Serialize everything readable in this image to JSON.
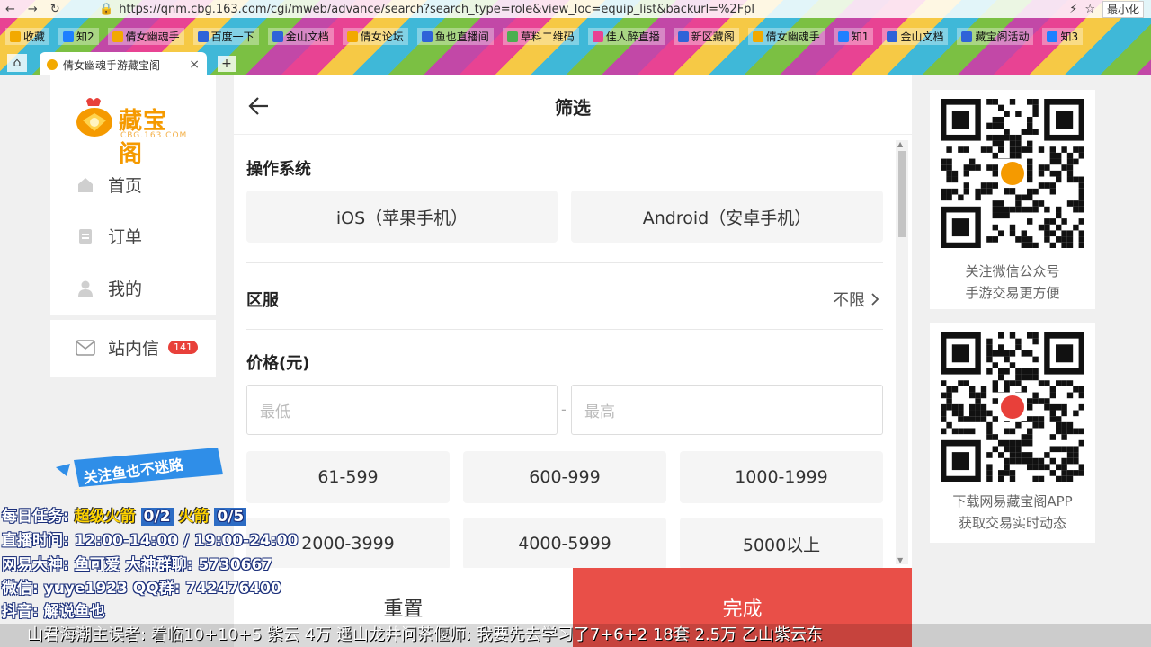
{
  "browser": {
    "url": "https://qnm.cbg.163.com/cgi/mweb/advance/search?search_type=role&view_loc=equip_list&backurl=%2Fpl",
    "minimize_label": "最小化",
    "tab_title": "倩女幽魂手游藏宝阁",
    "bookmarks": [
      {
        "label": "收藏",
        "color": "#f2a900"
      },
      {
        "label": "知2",
        "color": "#1e80ff"
      },
      {
        "label": "倩女幽魂手",
        "color": "#f2a900"
      },
      {
        "label": "百度一下",
        "color": "#2f63d8"
      },
      {
        "label": "金山文档",
        "color": "#2f63d8"
      },
      {
        "label": "倩女论坛",
        "color": "#f2a900"
      },
      {
        "label": "鱼也直播间",
        "color": "#2f63d8"
      },
      {
        "label": "草料二维码",
        "color": "#4caf50"
      },
      {
        "label": "佳人醉直播",
        "color": "#e84393"
      },
      {
        "label": "新区藏阁",
        "color": "#2f63d8"
      },
      {
        "label": "倩女幽魂手",
        "color": "#f2a900"
      },
      {
        "label": "知1",
        "color": "#1e80ff"
      },
      {
        "label": "金山文档",
        "color": "#2f63d8"
      },
      {
        "label": "藏宝阁活动",
        "color": "#2f63d8"
      },
      {
        "label": "知3",
        "color": "#1e80ff"
      }
    ]
  },
  "logo": {
    "text": "藏宝阁",
    "sub": "CBG.163.COM"
  },
  "sidebar": {
    "items": [
      {
        "label": "首页",
        "icon": "home-icon"
      },
      {
        "label": "订单",
        "icon": "order-icon"
      },
      {
        "label": "我的",
        "icon": "user-icon"
      }
    ],
    "messages": {
      "label": "站内信",
      "count": "141",
      "icon": "mail-icon"
    }
  },
  "filter": {
    "title": "筛选",
    "os": {
      "title": "操作系统",
      "options": [
        "iOS（苹果手机）",
        "Android（安卓手机）"
      ]
    },
    "region": {
      "title": "区服",
      "value": "不限"
    },
    "price": {
      "title": "价格(元)",
      "min_placeholder": "最低",
      "max_placeholder": "最高",
      "separator": "-",
      "ranges": [
        "61-599",
        "600-999",
        "1000-1999",
        "2000-3999",
        "4000-5999",
        "5000以上"
      ]
    },
    "reset_label": "重置",
    "done_label": "完成"
  },
  "qr_cards": [
    {
      "caption1": "关注微信公众号",
      "caption2": "手游交易更方便"
    },
    {
      "caption1": "下载网易藏宝阁APP",
      "caption2": "获取交易实时动态"
    }
  ],
  "overlay": {
    "banner": "关注鱼也不迷路",
    "task_label": "每日任务:",
    "task_item1": "超级火箭",
    "task_item1_progress": "0/2",
    "task_item2": "火箭",
    "task_item2_progress": "0/5",
    "time_line": "直播时间: 12:00-14:00 / 19:00-24:00",
    "netease_line": "网易大神: 鱼可爱   大神群聊: 5730667",
    "wechat_line": "微信: yuye1923   QQ群: 742476400",
    "douyin_line": "抖音: 解说鱼也",
    "ticker": "山君海潮主误者: 着临10+10+5 紫云 4万 遥山龙井问茶偃师: 我要先去学习了7+6+2 18套 2.5万 乙山紫云东"
  }
}
